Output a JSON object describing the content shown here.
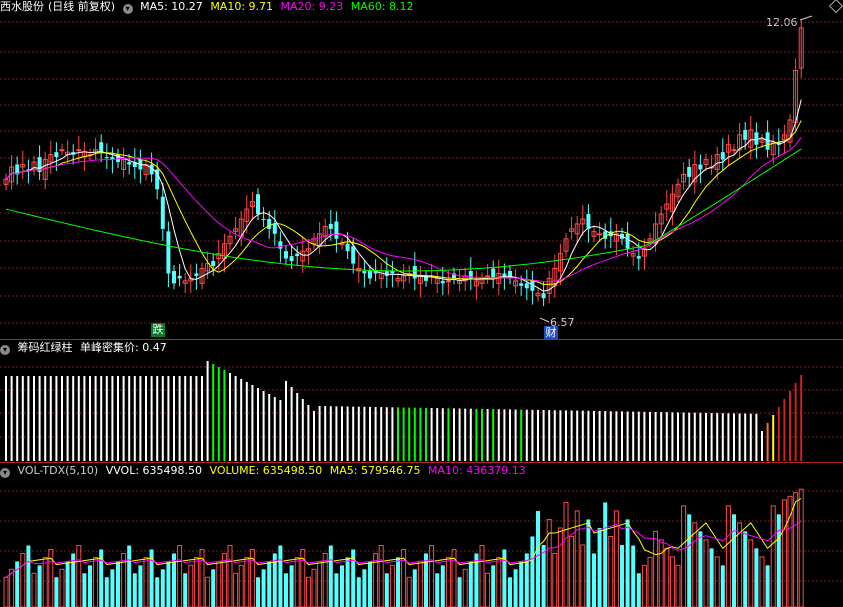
{
  "panel_price": {
    "stock_name": "西水股份",
    "period": "(日线 前复权)",
    "ma_labels": [
      {
        "text": "MA5: 10.27",
        "color": "#ffffff"
      },
      {
        "text": "MA10: 9.71",
        "color": "#ffff00"
      },
      {
        "text": "MA20: 9.23",
        "color": "#ff00ff"
      },
      {
        "text": "MA60: 8.12",
        "color": "#00ff00"
      }
    ],
    "high_label": "12.06",
    "low_label": "6.57",
    "tag_die": "跌",
    "tag_cai": "财"
  },
  "panel_chip": {
    "title": "筹码红绿柱",
    "indicator": "单峰密集价: 0.47"
  },
  "panel_volume": {
    "labels": [
      {
        "text": "VOL-TDX(5,10)",
        "color": "#cccccc"
      },
      {
        "text": "VVOL: 635498.50",
        "color": "#ffffff"
      },
      {
        "text": "VOLUME: 635498.50",
        "color": "#ffff00"
      },
      {
        "text": "MA5: 579546.75",
        "color": "#ffff00"
      },
      {
        "text": "MA10: 436379.13",
        "color": "#ff00ff"
      }
    ]
  },
  "colors": {
    "up": "#ff4a4a",
    "down": "#54ffff",
    "ma5": "#ffffff",
    "ma10": "#ffff00",
    "ma20": "#ff00ff",
    "ma60": "#00ff00",
    "grid": "#7a1f1f",
    "separator": "#b22222"
  },
  "chart_data": {
    "type": "candlestick",
    "close_prices": [
      9.0,
      9.25,
      9.1,
      9.3,
      9.2,
      9.35,
      9.15,
      9.4,
      9.5,
      9.45,
      9.6,
      9.55,
      9.5,
      9.6,
      9.55,
      9.5,
      9.6,
      9.55,
      9.45,
      9.4,
      9.35,
      9.4,
      9.3,
      9.25,
      9.2,
      9.3,
      9.1,
      8.8,
      8.0,
      7.1,
      6.9,
      7.0,
      6.95,
      7.0,
      7.05,
      7.2,
      7.3,
      7.25,
      7.5,
      7.7,
      7.85,
      8.0,
      8.2,
      8.4,
      8.55,
      8.3,
      8.2,
      8.0,
      7.9,
      7.6,
      7.4,
      7.35,
      7.45,
      7.55,
      7.6,
      7.8,
      7.9,
      8.05,
      8.0,
      7.8,
      7.7,
      7.55,
      7.3,
      7.2,
      7.1,
      7.0,
      7.1,
      7.15,
      7.05,
      7.1,
      7.0,
      7.05,
      7.1,
      7.0,
      7.05,
      6.95,
      7.05,
      7.0,
      6.9,
      6.95,
      7.0,
      6.95,
      7.05,
      7.0,
      6.95,
      7.0,
      7.05,
      7.0,
      7.1,
      7.05,
      7.0,
      6.95,
      6.85,
      6.8,
      6.75,
      6.7,
      6.6,
      7.0,
      7.2,
      7.5,
      7.8,
      8.0,
      8.1,
      8.2,
      8.0,
      7.95,
      7.9,
      7.8,
      7.85,
      7.9,
      7.8,
      7.6,
      7.5,
      7.4,
      7.6,
      7.8,
      8.1,
      8.3,
      8.5,
      8.7,
      8.9,
      9.1,
      9.05,
      9.3,
      9.2,
      9.4,
      9.25,
      9.5,
      9.4,
      9.7,
      9.6,
      9.9,
      9.8,
      10.0,
      9.7,
      9.8,
      9.6,
      9.75,
      9.7,
      9.9,
      10.2,
      11.2,
      12.06
    ],
    "vol_chip_bars": "white / green / yellow / red columns (chip distribution strength)",
    "ylim": [
      6.2,
      12.3
    ]
  }
}
